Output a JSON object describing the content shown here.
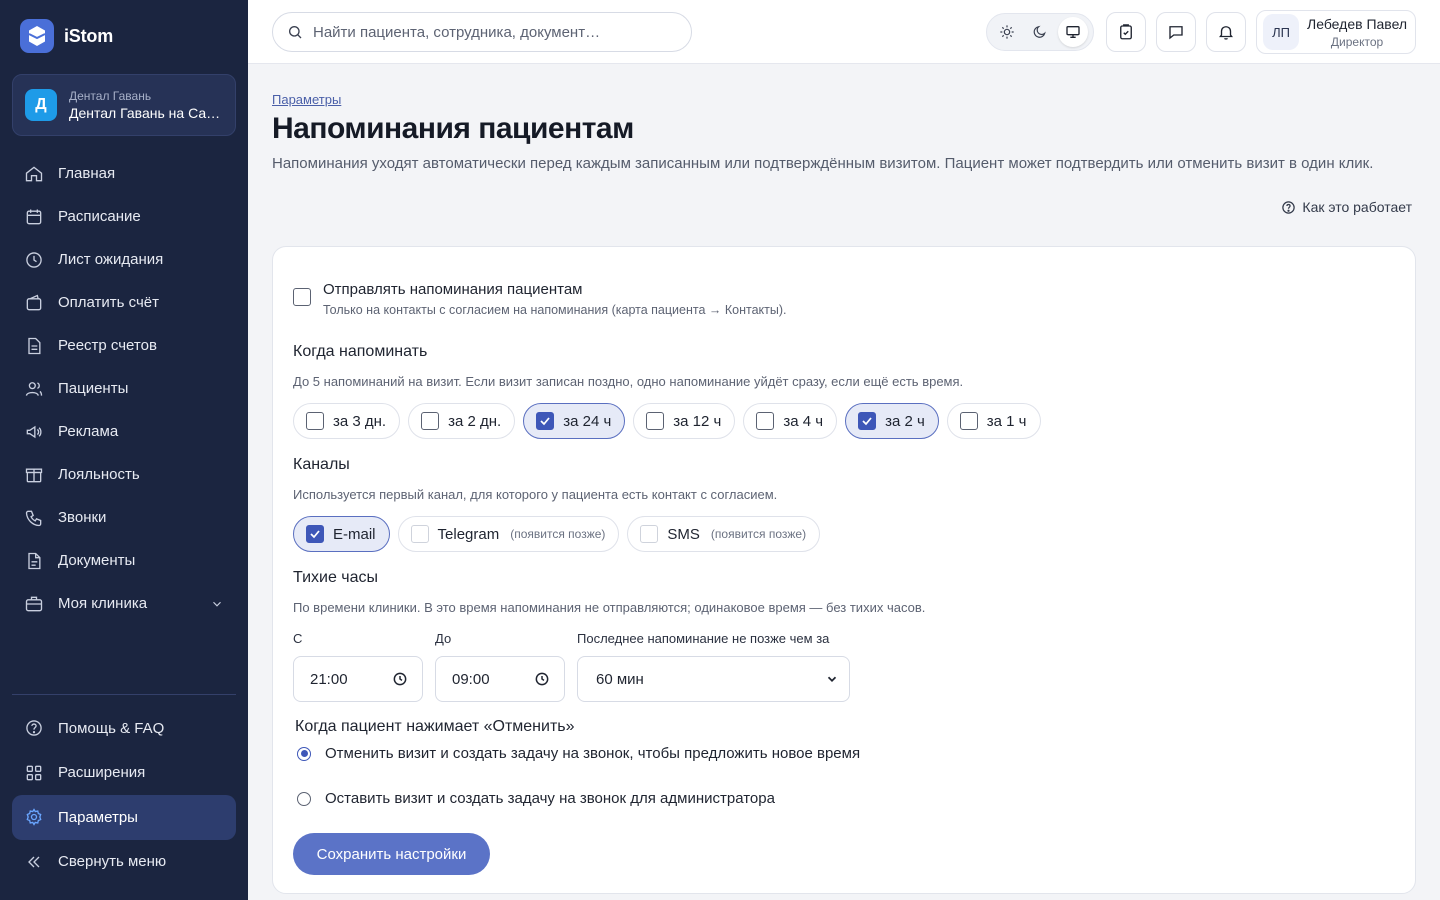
{
  "app": {
    "name": "iStom",
    "logo_icon": "tooth-icon"
  },
  "clinic": {
    "initial": "Д",
    "group": "Дентал Гавань",
    "name": "Дентал Гавань на Садовой"
  },
  "sidebar": {
    "items": [
      {
        "label": "Главная",
        "icon": "home-icon"
      },
      {
        "label": "Расписание",
        "icon": "calendar-icon"
      },
      {
        "label": "Лист ожидания",
        "icon": "clock-icon"
      },
      {
        "label": "Оплатить счёт",
        "icon": "wallet-icon"
      },
      {
        "label": "Реестр счетов",
        "icon": "document-icon"
      },
      {
        "label": "Пациенты",
        "icon": "users-icon"
      },
      {
        "label": "Реклама",
        "icon": "megaphone-icon"
      },
      {
        "label": "Лояльность",
        "icon": "gift-icon"
      },
      {
        "label": "Звонки",
        "icon": "phone-icon"
      },
      {
        "label": "Документы",
        "icon": "file-icon"
      },
      {
        "label": "Моя клиника",
        "icon": "briefcase-icon"
      }
    ],
    "bottom": [
      {
        "label": "Помощь & FAQ",
        "icon": "help-icon"
      },
      {
        "label": "Расширения",
        "icon": "extensions-icon"
      },
      {
        "label": "Параметры",
        "icon": "settings-icon",
        "active": true
      },
      {
        "label": "Свернуть меню",
        "icon": "collapse-icon"
      }
    ]
  },
  "topbar": {
    "search_placeholder": "Найти пациента, сотрудника, документ…",
    "user": {
      "initials": "ЛП",
      "name": "Лебедев Павел",
      "role": "Директор"
    }
  },
  "page": {
    "breadcrumb": "Параметры",
    "title": "Напоминания пациентам",
    "description": "Напоминания уходят автоматически перед каждым записанным или подтверждённым визитом. Пациент может подтвердить или отменить визит в один клик.",
    "help_link": "Как это работает"
  },
  "settings": {
    "enable": {
      "label": "Отправлять напоминания пациентам",
      "hint": "Только на контакты с согласием на напоминания (карта пациента → Контакты).",
      "checked": false
    },
    "when": {
      "title": "Когда напоминать",
      "hint": "До 5 напоминаний на визит. Если визит записан поздно, одно напоминание уйдёт сразу, если ещё есть время.",
      "options": [
        {
          "label": "за 3 дн.",
          "checked": false
        },
        {
          "label": "за 2 дн.",
          "checked": false
        },
        {
          "label": "за 24 ч",
          "checked": true
        },
        {
          "label": "за 12 ч",
          "checked": false
        },
        {
          "label": "за 4 ч",
          "checked": false
        },
        {
          "label": "за 2 ч",
          "checked": true
        },
        {
          "label": "за 1 ч",
          "checked": false
        }
      ]
    },
    "channels": {
      "title": "Каналы",
      "hint": "Используется первый канал, для которого у пациента есть контакт с согласием.",
      "options": [
        {
          "label": "E-mail",
          "checked": true,
          "note": ""
        },
        {
          "label": "Telegram",
          "checked": false,
          "note": "(появится позже)"
        },
        {
          "label": "SMS",
          "checked": false,
          "note": "(появится позже)"
        }
      ]
    },
    "quiet_hours": {
      "title": "Тихие часы",
      "hint": "По времени клиники. В это время напоминания не отправляются; одинаковое время — без тихих часов.",
      "from_label": "С",
      "from_value": "21:00",
      "to_label": "До",
      "to_value": "09:00",
      "last_label": "Последнее напоминание не позже чем за",
      "last_value": "60 мин"
    },
    "cancel": {
      "title": "Когда пациент нажимает «Отменить»",
      "options": [
        {
          "label": "Отменить визит и создать задачу на звонок, чтобы предложить новое время",
          "checked": true
        },
        {
          "label": "Оставить визит и создать задачу на звонок для администратора",
          "checked": false
        }
      ]
    },
    "save_label": "Сохранить настройки"
  },
  "colors": {
    "sidebar_bg": "#1b2540",
    "accent": "#3e57b8",
    "button": "#5b73c7"
  }
}
